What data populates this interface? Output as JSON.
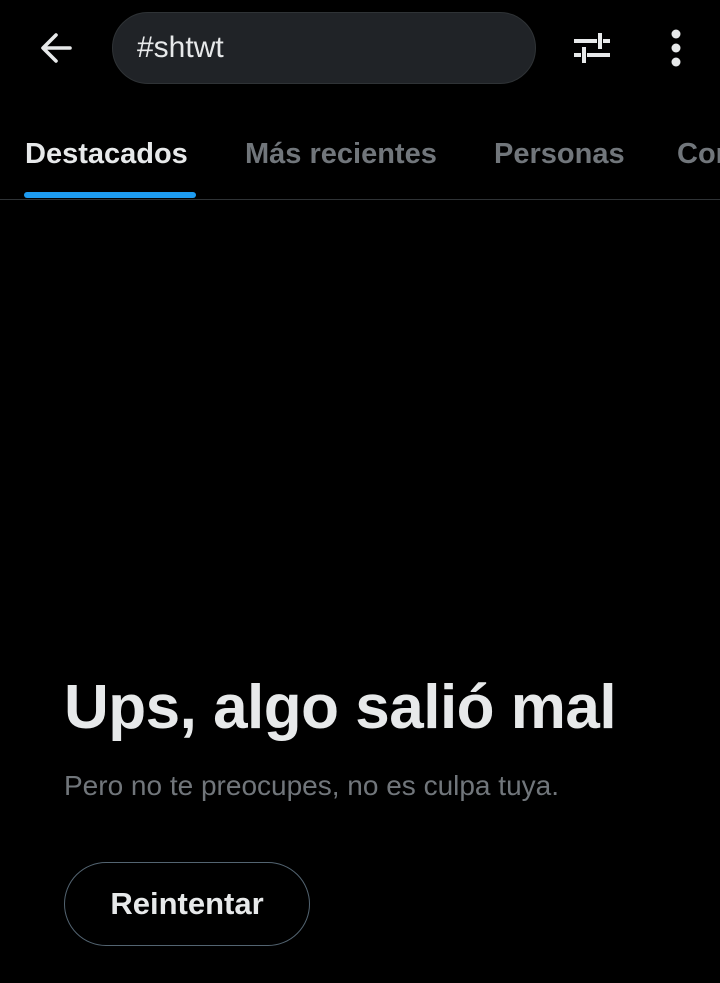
{
  "header": {
    "back_icon": "arrow-left-icon",
    "search": {
      "value": "#shtwt"
    },
    "filter_icon": "sliders-icon",
    "more_icon": "vertical-dots-icon"
  },
  "tabs": [
    {
      "label": "Destacados",
      "active": true
    },
    {
      "label": "Más recientes",
      "active": false
    },
    {
      "label": "Personas",
      "active": false
    },
    {
      "label": "Con",
      "active": false
    }
  ],
  "error": {
    "title": "Ups, algo salió mal",
    "subtitle": "Pero no te preocupes, no es culpa tuya.",
    "retry_label": "Reintentar"
  },
  "colors": {
    "background": "#000000",
    "primary_text": "#e7e9ea",
    "secondary_text": "#71767b",
    "accent": "#1d9bf0",
    "search_bg": "#202327",
    "border": "#2f3336"
  }
}
